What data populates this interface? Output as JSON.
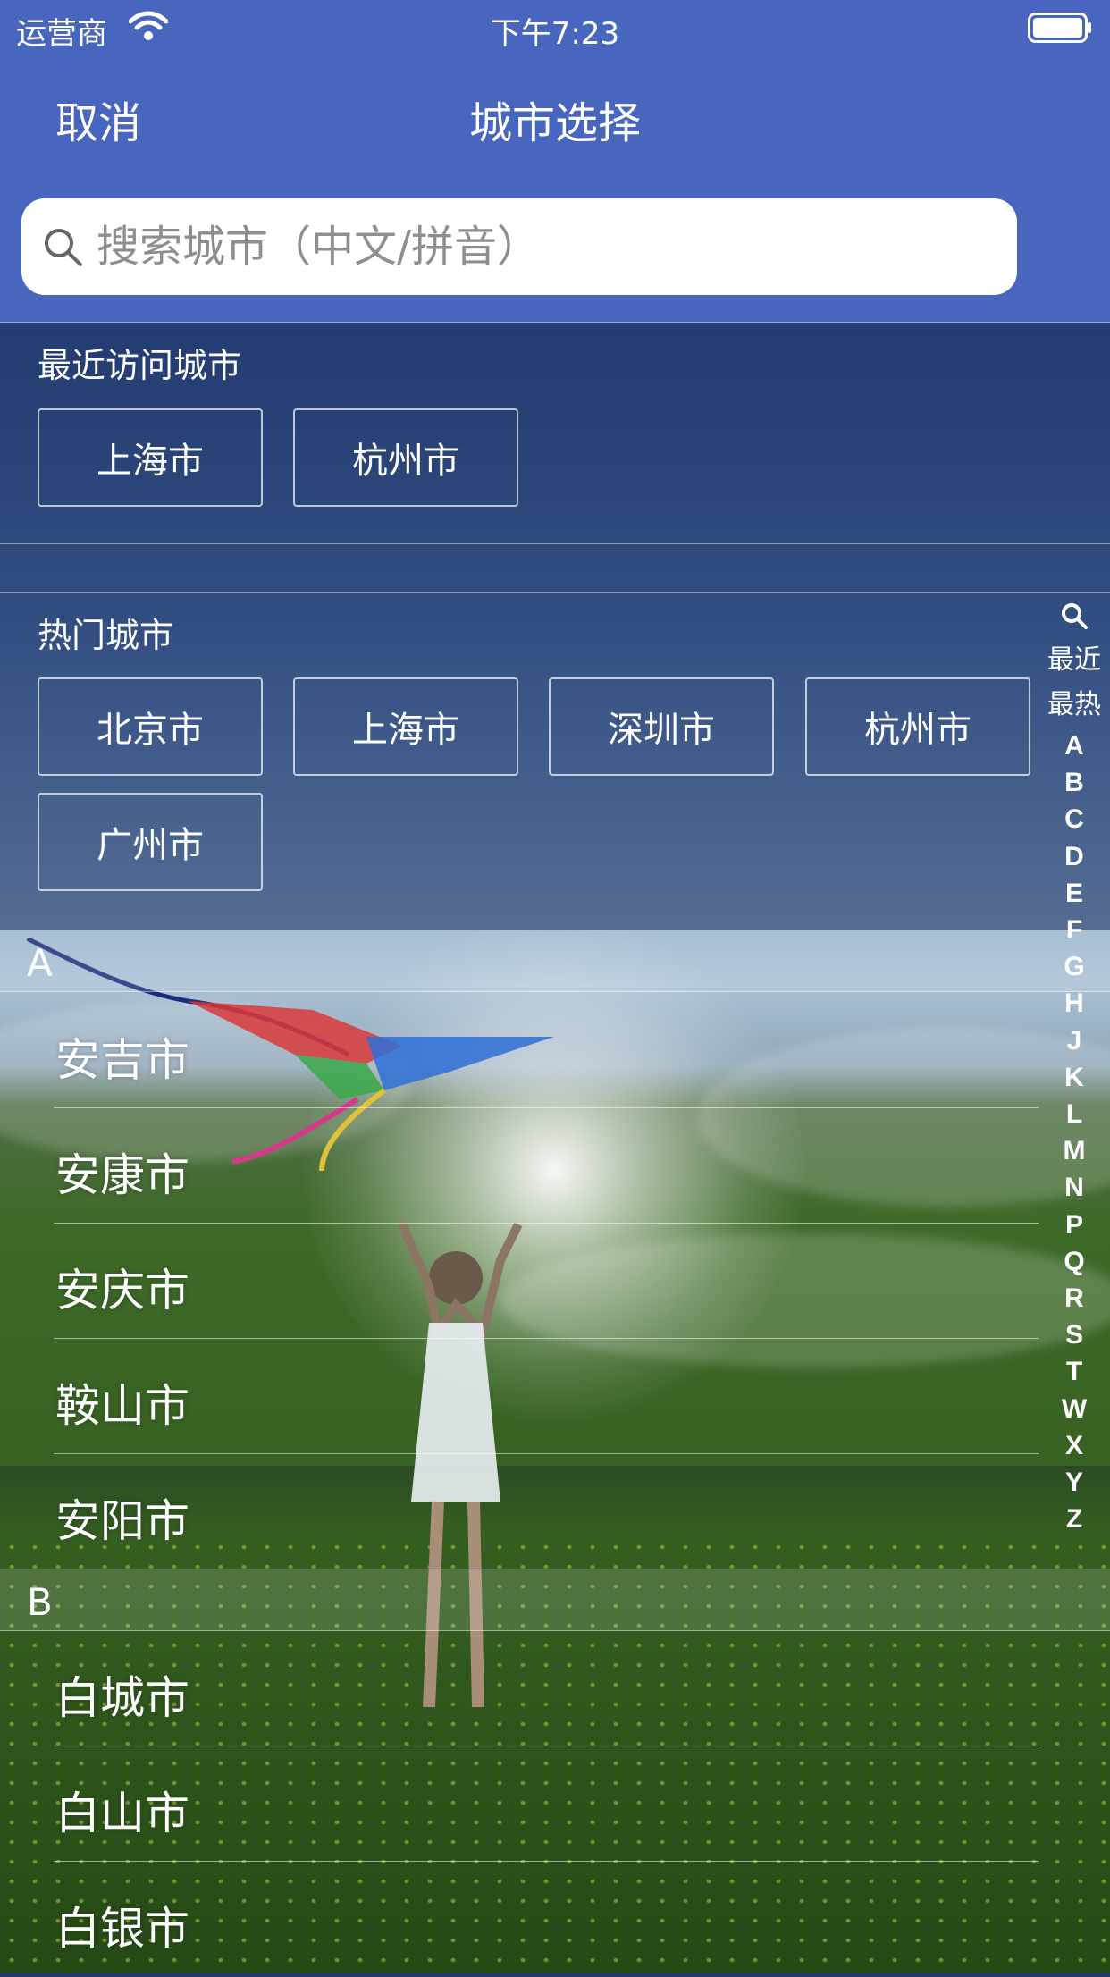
{
  "status_bar": {
    "carrier": "运营商",
    "time": "下午7:23"
  },
  "nav": {
    "cancel_label": "取消",
    "title": "城市选择"
  },
  "search": {
    "placeholder": "搜索城市（中文/拼音）"
  },
  "recent": {
    "title": "最近访问城市",
    "cities": [
      "上海市",
      "杭州市"
    ]
  },
  "hot": {
    "title": "热门城市",
    "cities": [
      "北京市",
      "上海市",
      "深圳市",
      "杭州市",
      "广州市"
    ]
  },
  "sections": [
    {
      "letter": "A",
      "cities": [
        "安吉市",
        "安康市",
        "安庆市",
        "鞍山市",
        "安阳市"
      ]
    },
    {
      "letter": "B",
      "cities": [
        "白城市",
        "白山市",
        "白银市"
      ]
    }
  ],
  "index_bar": {
    "search_icon": "search-icon",
    "items": [
      "最近",
      "最热",
      "A",
      "B",
      "C",
      "D",
      "E",
      "F",
      "G",
      "H",
      "J",
      "K",
      "L",
      "M",
      "N",
      "P",
      "Q",
      "R",
      "S",
      "T",
      "W",
      "X",
      "Y",
      "Z"
    ]
  },
  "colors": {
    "nav_background": "#4966bf",
    "text": "#ffffff",
    "search_placeholder": "#8e8e8e"
  }
}
